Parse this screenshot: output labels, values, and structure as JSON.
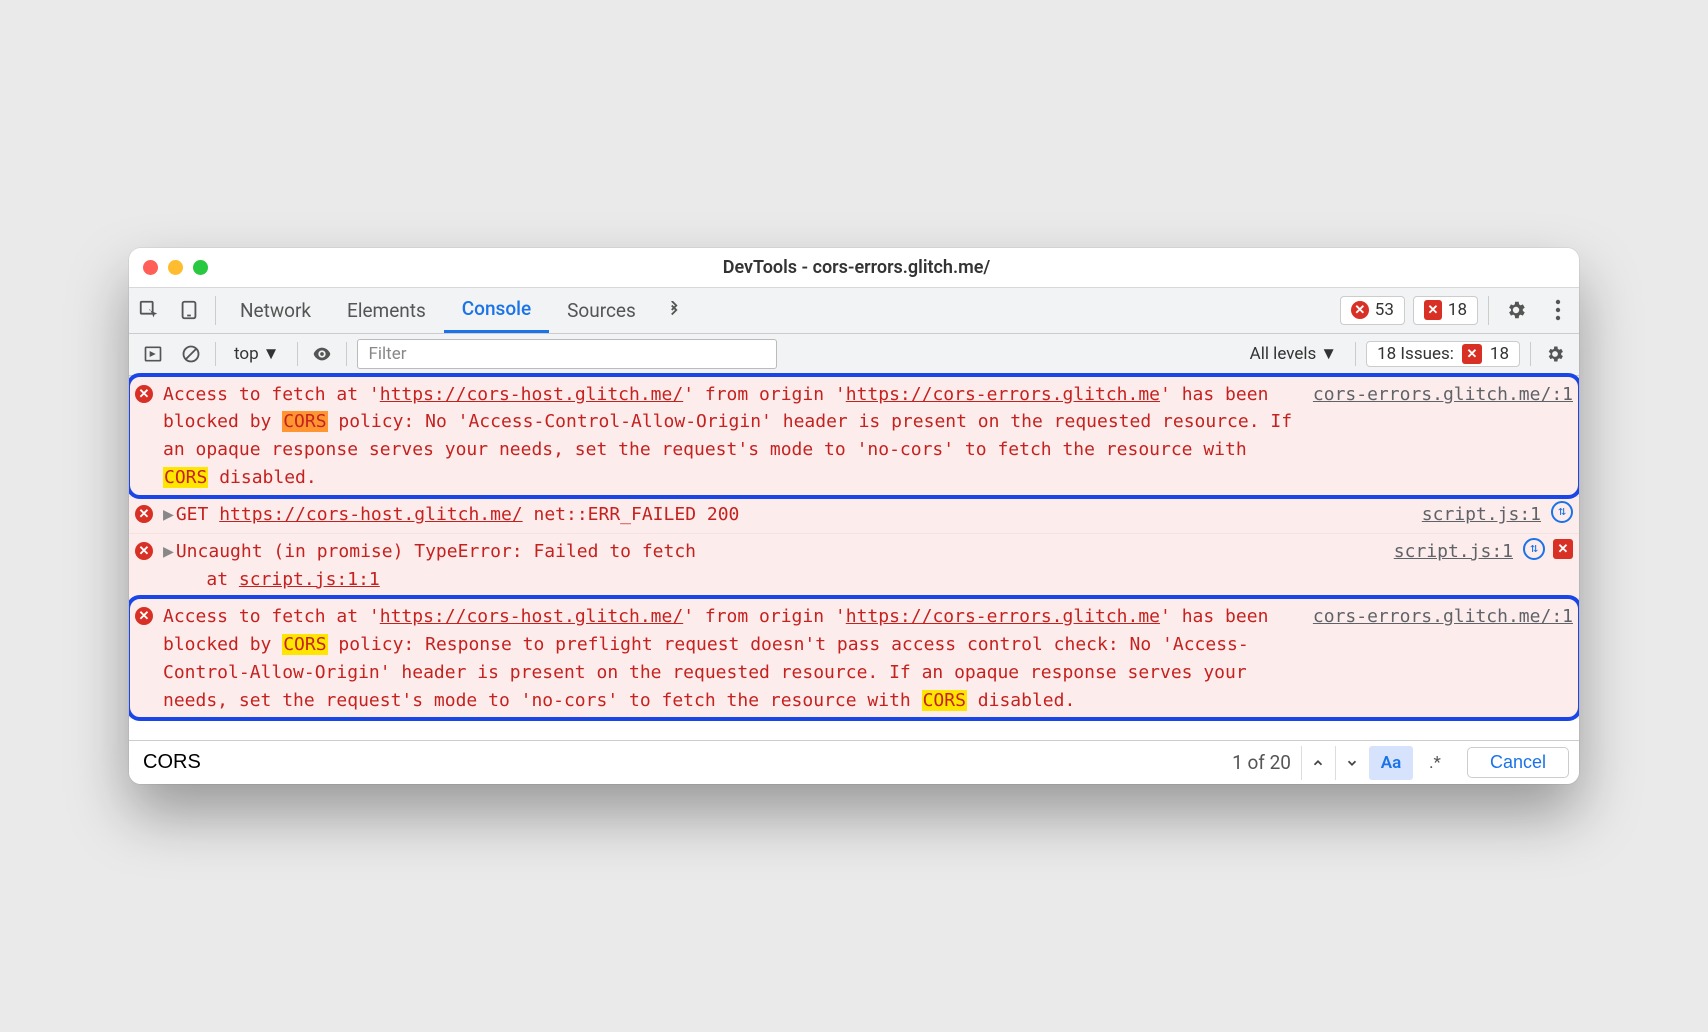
{
  "titlebar": {
    "title": "DevTools - cors-errors.glitch.me/"
  },
  "tabs": {
    "network": "Network",
    "elements": "Elements",
    "console": "Console",
    "sources": "Sources"
  },
  "counters": {
    "errors": "53",
    "issues": "18"
  },
  "toolbar": {
    "context": "top",
    "filter_placeholder": "Filter",
    "levels": "All levels",
    "issues_label": "18 Issues:",
    "issues_count": "18"
  },
  "rows": {
    "r1": {
      "pre1": "Access to fetch at '",
      "url1": "https://cors-host.glitch.me/",
      "mid1": "' from origin '",
      "url2": "https://cors-errors.glitch.me",
      "mid2": "' has been blocked by ",
      "cors1": "CORS",
      "mid3": " policy: No 'Access-Control-Allow-Origin' header is present on the requested resource. If an opaque response serves your needs, set the request's mode to 'no-cors' to fetch the resource with ",
      "cors2": "CORS",
      "tail": " disabled.",
      "source": "cors-errors.glitch.me/:1"
    },
    "r2": {
      "method": "GET ",
      "url": "https://cors-host.glitch.me/",
      "status": " net::ERR_FAILED 200",
      "source": "script.js:1"
    },
    "r3": {
      "msg": "Uncaught (in promise) TypeError: Failed to fetch",
      "at": "    at ",
      "stack": "script.js:1:1",
      "source": "script.js:1"
    },
    "r4": {
      "pre1": "Access to fetch at '",
      "url1": "https://cors-host.glitch.me/",
      "mid1": "' from origin '",
      "url2": "https://cors-errors.glitch.me",
      "mid2": "' has been blocked by ",
      "cors1": "CORS",
      "mid3": " policy: Response to preflight request doesn't pass access control check: No 'Access-Control-Allow-Origin' header is present on the requested resource. If an opaque response serves your needs, set the request's mode to 'no-cors' to fetch the resource with ",
      "cors2": "CORS",
      "tail": " disabled.",
      "source": "cors-errors.glitch.me/:1"
    }
  },
  "search": {
    "query": "CORS",
    "count": "1 of 20",
    "aa": "Aa",
    "regex": ".*",
    "cancel": "Cancel"
  }
}
